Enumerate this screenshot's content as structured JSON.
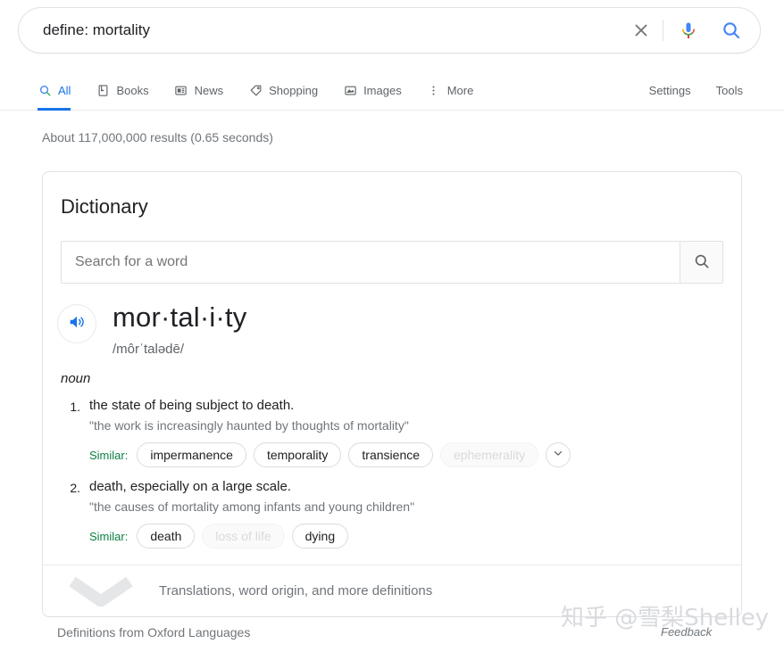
{
  "search": {
    "query": "define: mortality",
    "clear_icon": "close-icon",
    "mic_icon": "microphone-icon",
    "search_icon": "search-icon"
  },
  "nav": {
    "tabs": [
      {
        "label": "All",
        "icon": "search-icon",
        "active": true
      },
      {
        "label": "Books",
        "icon": "book-icon",
        "active": false
      },
      {
        "label": "News",
        "icon": "news-icon",
        "active": false
      },
      {
        "label": "Shopping",
        "icon": "tag-icon",
        "active": false
      },
      {
        "label": "Images",
        "icon": "image-icon",
        "active": false
      },
      {
        "label": "More",
        "icon": "more-vertical-icon",
        "active": false
      }
    ],
    "settings_label": "Settings",
    "tools_label": "Tools"
  },
  "result_stats": "About 117,000,000 results (0.65 seconds)",
  "card": {
    "title": "Dictionary",
    "word_search_placeholder": "Search for a word",
    "word_search_value": "",
    "word_search_icon": "search-icon",
    "speaker_icon": "volume-speaker-icon",
    "headword": "mor·tal·i·ty",
    "phonetic": "/môrˈtalədē/",
    "part_of_speech": "noun",
    "senses": [
      {
        "number": "1.",
        "definition": "the state of being subject to death.",
        "example": "\"the work is increasingly haunted by thoughts of mortality\"",
        "similar_label": "Similar:",
        "synonyms": [
          {
            "text": "impermanence",
            "faded": false
          },
          {
            "text": "temporality",
            "faded": false
          },
          {
            "text": "transience",
            "faded": false
          },
          {
            "text": "ephemerality",
            "faded": true
          }
        ],
        "expand_icon": "chevron-down-icon",
        "has_expand": true
      },
      {
        "number": "2.",
        "definition": "death, especially on a large scale.",
        "example": "\"the causes of mortality among infants and young children\"",
        "similar_label": "Similar:",
        "synonyms": [
          {
            "text": "death",
            "faded": false
          },
          {
            "text": "loss of life",
            "faded": true
          },
          {
            "text": "dying",
            "faded": false
          }
        ],
        "has_expand": false
      }
    ],
    "footer_text": "Translations, word origin, and more definitions",
    "footer_icon": "chevron-down-icon"
  },
  "source_note": "Definitions from Oxford Languages",
  "feedback_label": "Feedback",
  "watermark": "知乎 @雪梨Shelley",
  "colors": {
    "google_blue": "#1a73e8",
    "similar_green": "#0b8043",
    "text_primary": "#202124",
    "text_secondary": "#70757a",
    "border": "#dfe1e5"
  }
}
